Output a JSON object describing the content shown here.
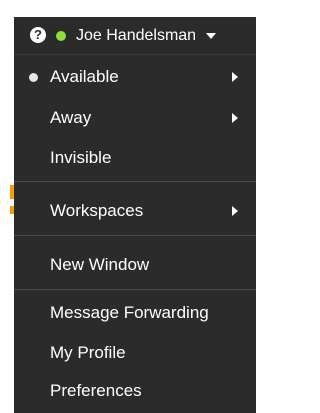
{
  "header": {
    "help_icon": "?",
    "user_name": "Joe Handelsman",
    "status_color": "#8ee03a"
  },
  "menu": {
    "items": [
      {
        "label": "Available",
        "bullet": true,
        "submenu": true
      },
      {
        "label": "Away",
        "bullet": false,
        "submenu": true
      },
      {
        "label": "Invisible",
        "bullet": false,
        "submenu": false
      },
      {
        "label": "Workspaces",
        "bullet": false,
        "submenu": true
      },
      {
        "label": "New Window",
        "bullet": false,
        "submenu": false
      },
      {
        "label": "Message Forwarding",
        "bullet": false,
        "submenu": false
      },
      {
        "label": "My Profile",
        "bullet": false,
        "submenu": false
      },
      {
        "label": "Preferences",
        "bullet": false,
        "submenu": false
      }
    ]
  },
  "colors": {
    "menu_background": "#2b2b2b",
    "text": "#ffffff",
    "divider": "#4a4a4a"
  }
}
